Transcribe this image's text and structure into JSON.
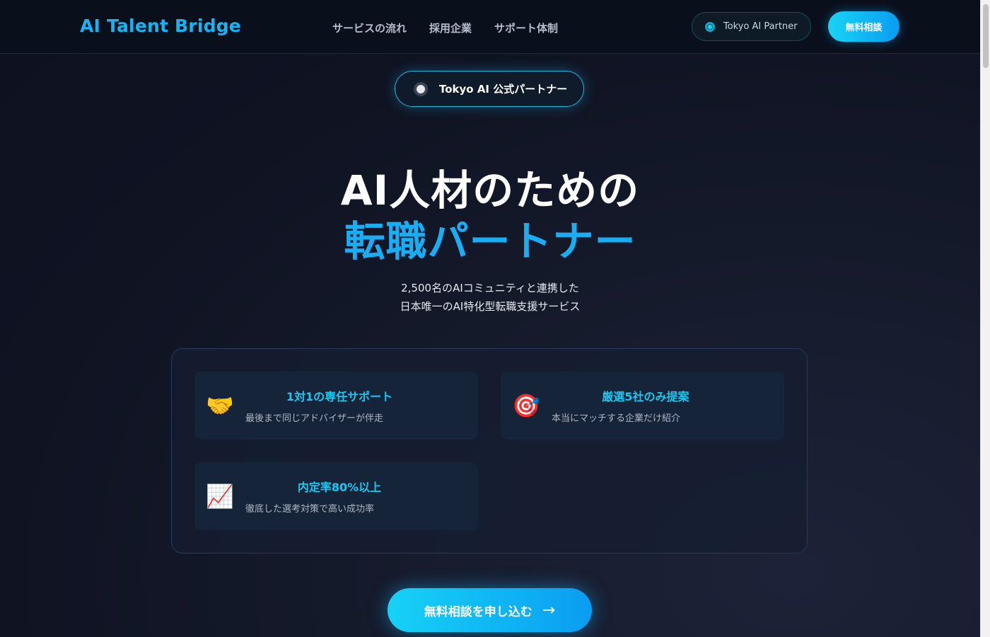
{
  "header": {
    "logo": "AI Talent Bridge",
    "nav": [
      "サービスの流れ",
      "採用企業",
      "サポート体制"
    ],
    "partner_label": "Tokyo AI Partner",
    "cta_label": "無料相談"
  },
  "hero": {
    "badge": "Tokyo AI 公式パートナー",
    "title_line1": "AI人材のための",
    "title_line2": "転職パートナー",
    "subtitle_line1": "2,500名のAIコミュニティと連携した",
    "subtitle_line2": "日本唯一のAI特化型転職支援サービス"
  },
  "features": [
    {
      "icon": "handshake-icon",
      "emoji": "🤝",
      "title": "1対1の専任サポート",
      "desc": "最後まで同じアドバイザーが伴走"
    },
    {
      "icon": "target-icon",
      "emoji": "🎯",
      "title": "厳選5社のみ提案",
      "desc": "本当にマッチする企業だけ紹介"
    },
    {
      "icon": "chart-up-icon",
      "emoji": "📈",
      "title": "内定率80%以上",
      "desc": "徹底した選考対策で高い成功率"
    }
  ],
  "cta": {
    "label": "無料相談を申し込む",
    "arrow": "→"
  },
  "colors": {
    "accent": "#18aef5",
    "accent_light": "#18c6f2",
    "background": "#0f1322",
    "header_bg": "#0a0f1c"
  }
}
